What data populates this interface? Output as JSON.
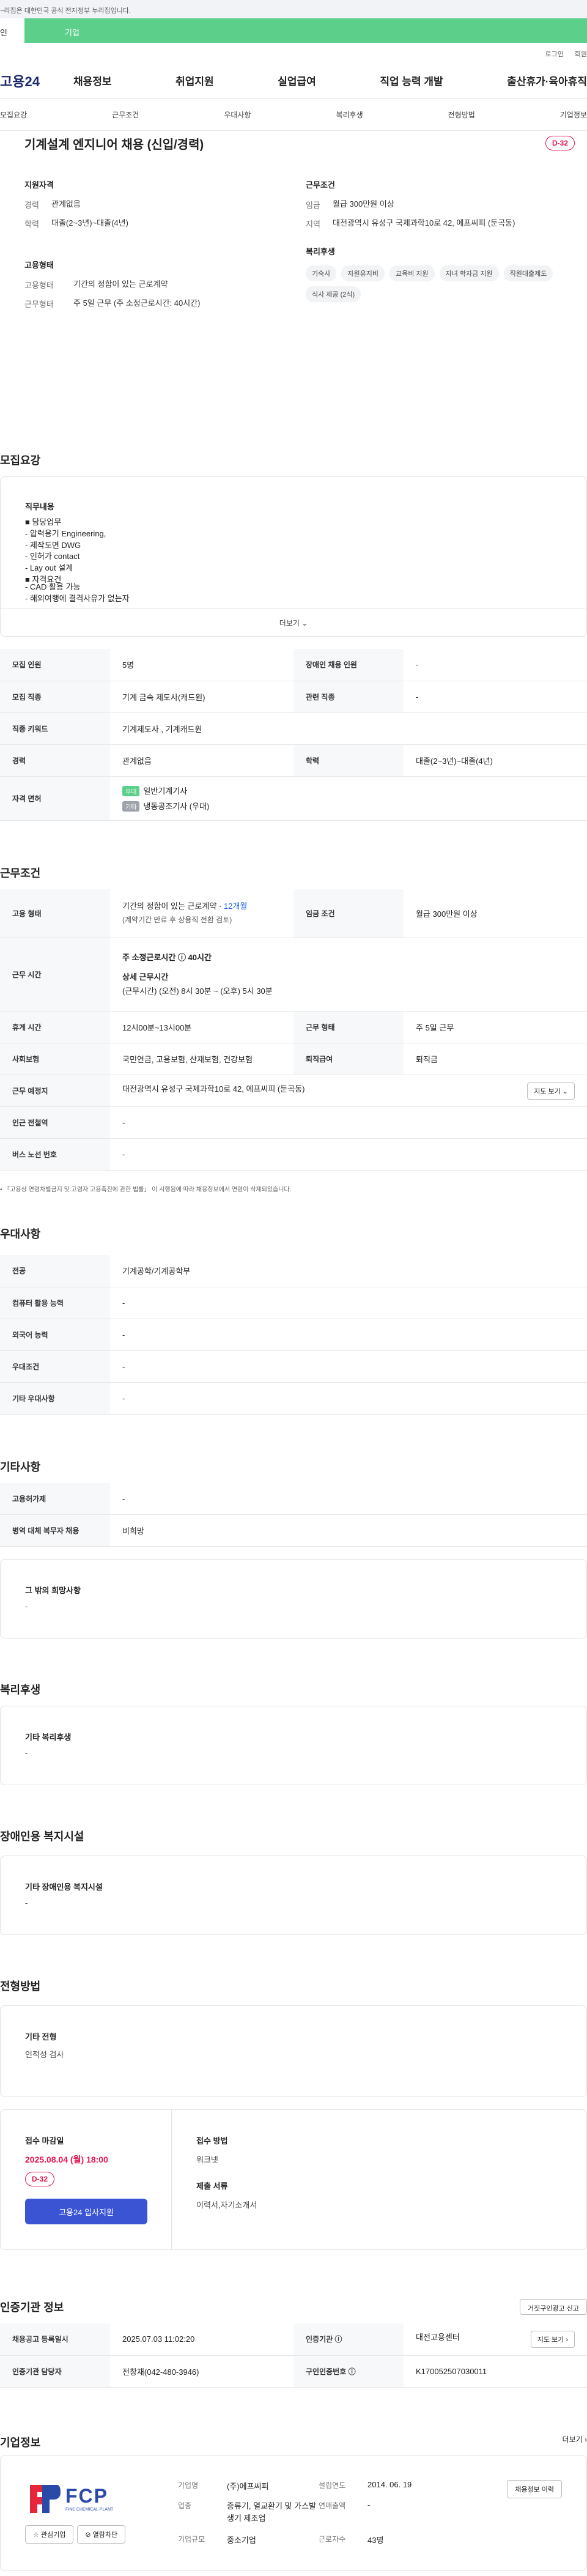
{
  "gov_bar": "~리집은 대한민국 공식 전자정부 누리집입니다.",
  "top_tabs": {
    "personal": "인",
    "company": "기업"
  },
  "util": {
    "login": "로그인",
    "signup": "회원"
  },
  "logo": "고용24",
  "gnb": [
    "채용정보",
    "취업지원",
    "실업급여",
    "직업 능력 개발",
    "출산휴가·육아휴직"
  ],
  "subnav": [
    "모집요강",
    "근무조건",
    "우대사항",
    "복리후생",
    "전형방법",
    "기업정보"
  ],
  "job": {
    "title": "기계설계 엔지니어 채용 (신입/경력)",
    "dday": "D-32",
    "qual_title": "지원자격",
    "qual": [
      {
        "k": "경력",
        "v": "관계없음"
      },
      {
        "k": "학력",
        "v": "대졸(2~3년)~대졸(4년)"
      }
    ],
    "cond_title": "근무조건",
    "cond": [
      {
        "k": "임금",
        "v": "월급 300만원 이상"
      },
      {
        "k": "지역",
        "v": "대전광역시 유성구 국제과학10로 42, 에프씨피 (둔곡동)"
      }
    ],
    "emp_title": "고용형태",
    "emp": [
      {
        "k": "고용형태",
        "v": "기간의 정함이 있는 근로계약"
      },
      {
        "k": "근무형태",
        "v": "주 5일 근무 (주 소정근로시간: 40시간)"
      }
    ],
    "welfare_title": "복리후생",
    "welfare_chips": [
      "기숙사",
      "자원유지비",
      "교육비 지원",
      "자녀 학자금 지원",
      "직원대출제도",
      "식사 제공 (2식)"
    ]
  },
  "recruit": {
    "section": "모집요강",
    "desc_lines": [
      "직무내용",
      "",
      "■ 담당업무",
      "- 압력용기 Engineering,",
      "- 제작도면 DWG",
      "- 인허가 contact",
      "- Lay out 설계",
      "",
      "■ 자격요건",
      "- CAD 활용 가능",
      "- 해외여행에 결격사유가 없는자"
    ],
    "more": "더보기 ⌄",
    "rows": [
      {
        "k1": "모집 인원",
        "v1": "5명",
        "k2": "장애인 채용 인원",
        "v2": "-"
      },
      {
        "k1": "모집 직종",
        "v1": "기계 금속 제도사(캐드원)",
        "k2": "관련 직종",
        "v2": "-"
      },
      {
        "k1": "직종 키워드",
        "v1": "기계제도사 , 기계캐드원",
        "k2": "",
        "v2": ""
      },
      {
        "k1": "경력",
        "v1": "관계없음",
        "k2": "학력",
        "v2": "대졸(2~3년)~대졸(4년)"
      }
    ],
    "license_label": "자격 면허",
    "licenses": [
      {
        "badge": "우대",
        "name": "일반기계기사"
      },
      {
        "badge": "기타",
        "name": "냉동공조기사 (우대)"
      }
    ]
  },
  "work": {
    "section": "근무조건",
    "emp_label": "고용 형태",
    "emp_value": "기간의 정함이 있는 근로계약 · ",
    "emp_months": "12개월",
    "emp_sub": "(계약기간 만료 후 상용직 전환 검토)",
    "wage_label": "임금 조건",
    "wage_value": "월급 300만원 이상",
    "hours_label": "근무 시간",
    "hours_main": "주 소정근로시간 ⓘ 40시간",
    "hours_detail_title": "상세 근무시간",
    "hours_detail": "(근무시간) (오전) 8시 30분 ~ (오후) 5시 30분",
    "rest_label": "휴게 시간",
    "rest_value": "12시00분~13시00분",
    "type_label": "근무 형태",
    "type_value": "주 5일 근무",
    "ins_label": "사회보험",
    "ins_value": "국민연금, 고용보험, 산재보험, 건강보험",
    "ret_label": "퇴직급여",
    "ret_value": "퇴직금",
    "place_label": "근무 예정지",
    "place_value": "대전광역시 유성구 국제과학10로 42, 에프씨피 (둔곡동)",
    "map_btn": "지도 보기 ⌄",
    "subway_label": "인근 전철역",
    "subway_value": "-",
    "bus_label": "버스 노선 번호",
    "bus_value": "-",
    "note": "「고용상 연령차별금지 및 고령자 고용촉진에 관한 법률」 이 시행됨에 따라 채용정보에서 연령이 삭제되었습니다."
  },
  "pref": {
    "section": "우대사항",
    "rows": [
      {
        "k": "전공",
        "v": "기계공학/기계공학부"
      },
      {
        "k": "컴퓨터 활용 능력",
        "v": "-"
      },
      {
        "k": "외국어 능력",
        "v": "-"
      },
      {
        "k": "우대조건",
        "v": "-"
      },
      {
        "k": "기타 우대사항",
        "v": "-"
      }
    ]
  },
  "etc": {
    "section": "기타사항",
    "rows": [
      {
        "k": "고용허가제",
        "v": "-"
      },
      {
        "k": "병역 대체 복무자 채용",
        "v": "비희망"
      }
    ],
    "box_title": "그 밖의 희망사항",
    "box_value": "-"
  },
  "benefit": {
    "section": "복리후생",
    "box_title": "기타 복리후생",
    "box_value": "-"
  },
  "disabled": {
    "section": "장애인용 복지시설",
    "box_title": "기타 장애인용 복지시설",
    "box_value": "-"
  },
  "process": {
    "section": "전형방법",
    "box_title": "기타 전형",
    "box_value": "인적성 검사",
    "deadline_label": "접수 마감일",
    "deadline": "2025.08.04 (월) 18:00",
    "dday": "D-32",
    "apply_btn": "고용24 입사지원",
    "method_label": "접수 방법",
    "method": "워크넷",
    "docs_label": "제출 서류",
    "docs": "이력서,자기소개서"
  },
  "cert": {
    "section": "인증기관 정보",
    "report_btn": "거짓구인광고 신고",
    "rows": [
      {
        "k1": "채용공고 등록일시",
        "v1": "2025.07.03 11:02:20",
        "k2": "인증기관 ⓘ",
        "v2": "대전고용센터"
      },
      {
        "k1": "인증기관 담당자",
        "v1": "전창재(042-480-3946)",
        "k2": "구인인증번호 ⓘ",
        "v2": "K170052507030011"
      }
    ],
    "map_btn": "지도 보기 ›"
  },
  "company": {
    "section": "기업정보",
    "more": "더보기 ›",
    "logo_text": "FCP",
    "logo_sub": "FINE CHEMICAL PLANT",
    "fav_btn": "☆ 관심기업",
    "block_btn": "⊘ 열람차단",
    "name_label": "기업명",
    "name": "(주)에프씨피",
    "year_label": "설립연도",
    "year": "2014. 06. 19",
    "ind_label": "업종",
    "ind": "증류기, 열교환기 및 가스발생기 제조업",
    "sales_label": "연매출액",
    "sales": "-",
    "emp_label": "근로자수",
    "emp": "43명",
    "size_label": "기업규모",
    "size": "중소기업",
    "jobs_btn": "채용정보 이력"
  }
}
